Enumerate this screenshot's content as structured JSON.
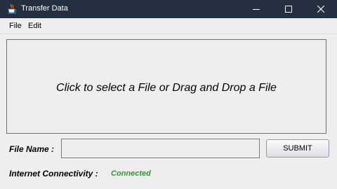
{
  "window": {
    "title": "Transfer Data",
    "icon": "java-cup-icon"
  },
  "menu": {
    "items": [
      {
        "label": "File"
      },
      {
        "label": "Edit"
      }
    ]
  },
  "drop_zone": {
    "text": "Click to select a File or Drag and Drop a File"
  },
  "form": {
    "file_name_label": "File Name :",
    "file_name_value": "",
    "submit_label": "SUBMIT",
    "connectivity_label": "Internet Connectivity :",
    "connectivity_status": "Connected"
  },
  "colors": {
    "titlebar": "#243040",
    "status_connected": "#2e9a2e"
  }
}
